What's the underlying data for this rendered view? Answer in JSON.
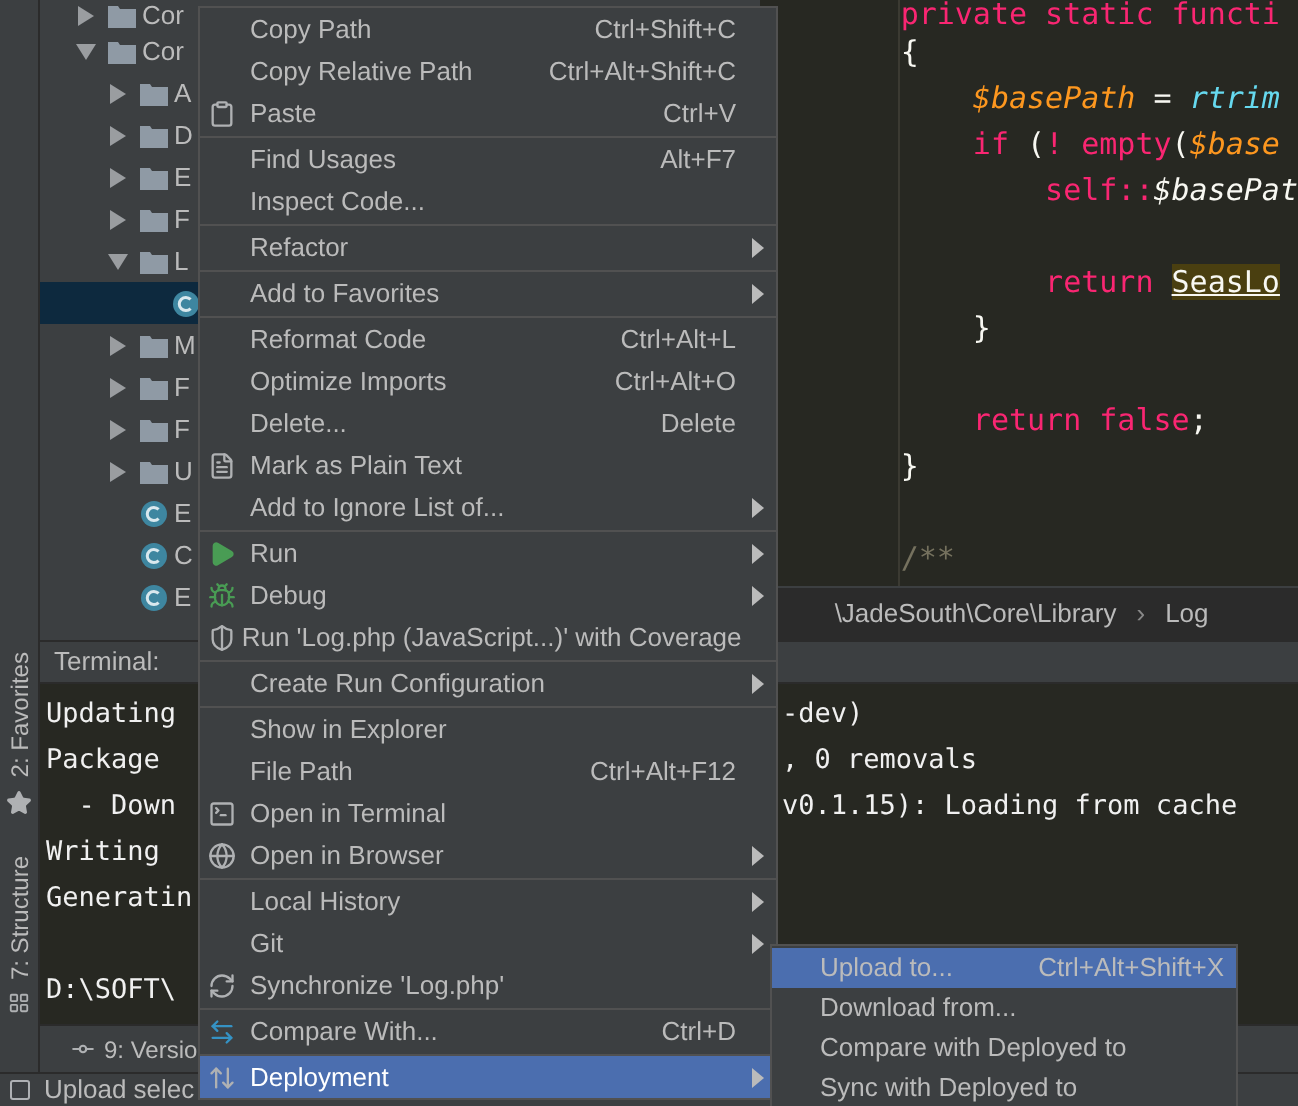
{
  "left_stripe": {
    "tabs": [
      {
        "label": "2: Favorites"
      },
      {
        "label": "7: Structure"
      }
    ]
  },
  "project_tree": {
    "items": [
      {
        "label": "Cor",
        "expanded": false,
        "selected": false
      },
      {
        "label": "Cor",
        "expanded": true,
        "selected": false,
        "children": [
          {
            "label": "A",
            "kind": "folder",
            "expanded": false,
            "selected": false
          },
          {
            "label": "D",
            "kind": "folder",
            "expanded": false,
            "selected": false
          },
          {
            "label": "E",
            "kind": "folder",
            "expanded": false,
            "selected": false
          },
          {
            "label": "F",
            "kind": "folder",
            "expanded": false,
            "selected": false
          },
          {
            "label": "L",
            "kind": "folder",
            "expanded": true,
            "selected": false,
            "children": [
              {
                "kind": "file",
                "selected": true
              }
            ]
          },
          {
            "label": "M",
            "kind": "folder",
            "expanded": false,
            "selected": false
          },
          {
            "label": "F",
            "kind": "folder",
            "expanded": false,
            "selected": false
          },
          {
            "label": "F",
            "kind": "folder",
            "expanded": false,
            "selected": false
          },
          {
            "label": "U",
            "kind": "folder",
            "expanded": false,
            "selected": false
          },
          {
            "label": "E",
            "kind": "class",
            "selected": false
          },
          {
            "label": "C",
            "kind": "class",
            "selected": false
          },
          {
            "label": "E",
            "kind": "class",
            "selected": false
          }
        ]
      }
    ]
  },
  "editor": {
    "lines": [
      {
        "kind": "code",
        "tokens": [
          {
            "text": "private static functi",
            "kind": "keyword"
          }
        ]
      },
      {
        "kind": "code",
        "tokens": [
          {
            "text": "{",
            "kind": "punct"
          }
        ]
      },
      {
        "kind": "code",
        "tokens": [
          {
            "text": "    $basePath",
            "kind": "variable"
          },
          {
            "text": " = ",
            "kind": "punct"
          },
          {
            "text": "rtrim",
            "kind": "function"
          }
        ]
      },
      {
        "kind": "code",
        "tokens": [
          {
            "text": "    if",
            "kind": "keyword"
          },
          {
            "text": " (",
            "kind": "punct"
          },
          {
            "text": "! empty",
            "kind": "keyword"
          },
          {
            "text": "(",
            "kind": "punct"
          },
          {
            "text": "$base",
            "kind": "variable"
          }
        ]
      },
      {
        "kind": "code",
        "tokens": [
          {
            "text": "        self::",
            "kind": "keyword"
          },
          {
            "text": "$basePat",
            "kind": "property"
          }
        ]
      },
      {
        "kind": "blank"
      },
      {
        "kind": "code",
        "tokens": [
          {
            "text": "        return ",
            "kind": "keyword"
          },
          {
            "text": "SeasLo",
            "kind": "highlight"
          }
        ]
      },
      {
        "kind": "code",
        "tokens": [
          {
            "text": "    }",
            "kind": "punct"
          }
        ]
      },
      {
        "kind": "blank"
      },
      {
        "kind": "code",
        "tokens": [
          {
            "text": "    return false",
            "kind": "keyword"
          },
          {
            "text": ";",
            "kind": "punct"
          }
        ]
      },
      {
        "kind": "code",
        "tokens": [
          {
            "text": "}",
            "kind": "punct"
          }
        ]
      },
      {
        "kind": "blank"
      },
      {
        "kind": "code",
        "tokens": [
          {
            "text": "/**",
            "kind": "comment"
          }
        ]
      }
    ],
    "breadcrumb": {
      "items": [
        "\\JadeSouth\\Core\\Library",
        "Log"
      ],
      "separator": "›"
    }
  },
  "terminal": {
    "title": "Terminal:",
    "lines": [
      {
        "kind": "text",
        "left": "Updating",
        "right": "-dev)"
      },
      {
        "kind": "text",
        "left": "Package",
        "right": ", 0 removals"
      },
      {
        "kind": "text",
        "left": "  - Down",
        "right": "v0.1.15): Loading from cache"
      },
      {
        "kind": "text",
        "left": "Writing"
      },
      {
        "kind": "text",
        "left": "Generatin"
      },
      {
        "kind": "blank"
      },
      {
        "kind": "text",
        "left": "D:\\SOFT\\"
      }
    ]
  },
  "bottom_tab": {
    "label": "9: Versio"
  },
  "status_bar": {
    "text": "Upload selec"
  },
  "context_menu": {
    "items": [
      {
        "kind": "item",
        "label": "Copy Path",
        "shortcut": "Ctrl+Shift+C",
        "submenu": false,
        "selected": false
      },
      {
        "kind": "item",
        "label": "Copy Relative Path",
        "shortcut": "Ctrl+Alt+Shift+C",
        "submenu": false,
        "selected": false
      },
      {
        "kind": "item",
        "label": "Paste",
        "shortcut": "Ctrl+V",
        "submenu": false,
        "selected": false
      },
      {
        "kind": "separator"
      },
      {
        "kind": "item",
        "label": "Find Usages",
        "shortcut": "Alt+F7",
        "submenu": false,
        "selected": false
      },
      {
        "kind": "item",
        "label": "Inspect Code...",
        "submenu": false,
        "selected": false
      },
      {
        "kind": "separator"
      },
      {
        "kind": "item",
        "label": "Refactor",
        "submenu": true,
        "selected": false
      },
      {
        "kind": "separator"
      },
      {
        "kind": "item",
        "label": "Add to Favorites",
        "submenu": true,
        "selected": false
      },
      {
        "kind": "separator"
      },
      {
        "kind": "item",
        "label": "Reformat Code",
        "shortcut": "Ctrl+Alt+L",
        "submenu": false,
        "selected": false
      },
      {
        "kind": "item",
        "label": "Optimize Imports",
        "shortcut": "Ctrl+Alt+O",
        "submenu": false,
        "selected": false
      },
      {
        "kind": "item",
        "label": "Delete...",
        "shortcut": "Delete",
        "submenu": false,
        "selected": false
      },
      {
        "kind": "item",
        "label": "Mark as Plain Text",
        "submenu": false,
        "selected": false
      },
      {
        "kind": "item",
        "label": "Add to Ignore List of...",
        "submenu": true,
        "selected": false
      },
      {
        "kind": "separator"
      },
      {
        "kind": "item",
        "label": "Run",
        "submenu": true,
        "selected": false
      },
      {
        "kind": "item",
        "label": "Debug",
        "submenu": true,
        "selected": false
      },
      {
        "kind": "item",
        "label": "Run 'Log.php (JavaScript...)' with Coverage",
        "submenu": false,
        "selected": false
      },
      {
        "kind": "separator"
      },
      {
        "kind": "item",
        "label": "Create Run Configuration",
        "submenu": true,
        "selected": false
      },
      {
        "kind": "separator"
      },
      {
        "kind": "item",
        "label": "Show in Explorer",
        "submenu": false,
        "selected": false
      },
      {
        "kind": "item",
        "label": "File Path",
        "shortcut": "Ctrl+Alt+F12",
        "submenu": false,
        "selected": false
      },
      {
        "kind": "item",
        "label": "Open in Terminal",
        "submenu": false,
        "selected": false
      },
      {
        "kind": "item",
        "label": "Open in Browser",
        "submenu": true,
        "selected": false
      },
      {
        "kind": "separator"
      },
      {
        "kind": "item",
        "label": "Local History",
        "submenu": true,
        "selected": false
      },
      {
        "kind": "item",
        "label": "Git",
        "submenu": true,
        "selected": false
      },
      {
        "kind": "item",
        "label": "Synchronize 'Log.php'",
        "submenu": false,
        "selected": false
      },
      {
        "kind": "separator"
      },
      {
        "kind": "item",
        "label": "Compare With...",
        "shortcut": "Ctrl+D",
        "submenu": false,
        "selected": false
      },
      {
        "kind": "separator"
      },
      {
        "kind": "item",
        "label": "Deployment",
        "submenu": true,
        "selected": true
      }
    ]
  },
  "submenu": {
    "items": [
      {
        "label": "Upload to...",
        "shortcut": "Ctrl+Alt+Shift+X",
        "selected": true
      },
      {
        "label": "Download from...",
        "selected": false
      },
      {
        "label": "Compare with Deployed to",
        "selected": false
      },
      {
        "label": "Sync with Deployed to",
        "selected": false
      }
    ]
  }
}
